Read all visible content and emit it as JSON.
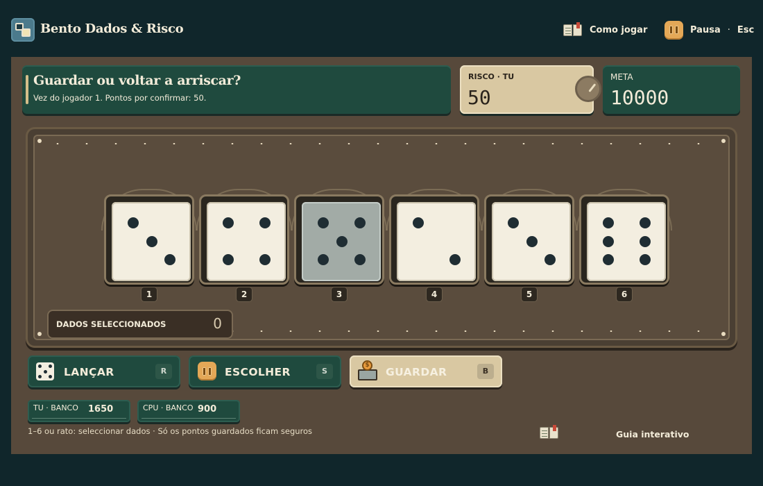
{
  "app": {
    "title": "Bento Dados & Risco"
  },
  "header": {
    "help_label": "Como jogar",
    "pause_label": "Pausa",
    "pause_separator": "·",
    "pause_key": "Esc"
  },
  "prompt": {
    "title": "Guardar ou voltar a arriscar?",
    "subtitle": "Vez do jogador 1. Pontos por confirmar: 50."
  },
  "risk": {
    "label": "RISCO · TU",
    "value": "50"
  },
  "goal": {
    "label": "META",
    "value": "10000"
  },
  "dice": [
    {
      "index": "1",
      "value": 3,
      "selected": false
    },
    {
      "index": "2",
      "value": 4,
      "selected": false
    },
    {
      "index": "3",
      "value": 5,
      "selected": true
    },
    {
      "index": "4",
      "value": 2,
      "selected": false
    },
    {
      "index": "5",
      "value": 3,
      "selected": false
    },
    {
      "index": "6",
      "value": 6,
      "selected": false
    }
  ],
  "selected_dice": {
    "label": "DADOS SELECCIONADOS",
    "count": "0"
  },
  "actions": {
    "roll": {
      "label": "LANÇAR",
      "key": "R",
      "icon": "die-icon"
    },
    "choose": {
      "label": "ESCOLHER",
      "key": "S",
      "icon": "pause-icon"
    },
    "bank": {
      "label": "GUARDAR",
      "key": "B",
      "icon": "bank-coin-icon"
    }
  },
  "banks": {
    "player": {
      "label": "TU · BANCO",
      "value": "1650"
    },
    "cpu": {
      "label": "CPU · BANCO",
      "value": "900"
    }
  },
  "footer": {
    "hint": "1–6 ou rato: seleccionar dados · Só os pontos guardados ficam seguros",
    "guide_label": "Guia interativo"
  },
  "colors": {
    "background": "#10262b",
    "panel": "#57493b",
    "green_panel": "#1f4a3e",
    "beige_panel": "#d9c8a2",
    "accent_orange": "#e4a857",
    "die_face": "#f3eee0",
    "die_selected": "#a2aba6"
  }
}
